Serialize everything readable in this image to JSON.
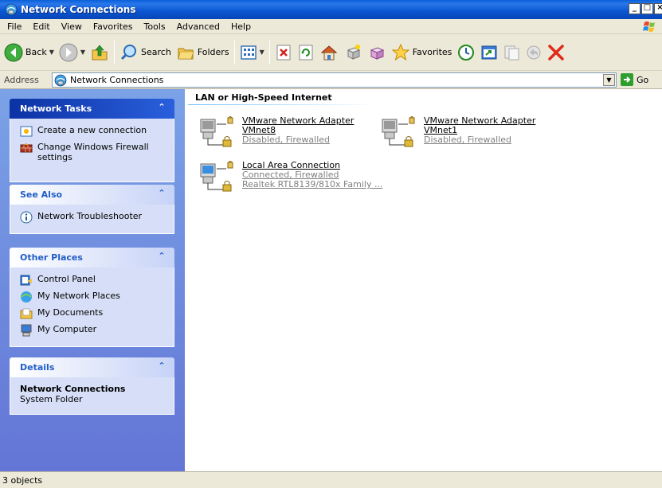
{
  "window": {
    "title": "Network Connections"
  },
  "menu": [
    "File",
    "Edit",
    "View",
    "Favorites",
    "Tools",
    "Advanced",
    "Help"
  ],
  "toolbar": {
    "back_label": "Back",
    "search_label": "Search",
    "folders_label": "Folders",
    "favorites_label": "Favorites"
  },
  "address": {
    "label": "Address",
    "value": "Network Connections",
    "go_label": "Go"
  },
  "taskpane": {
    "network_tasks": {
      "title": "Network Tasks",
      "items": [
        "Create a new connection",
        "Change Windows Firewall settings"
      ]
    },
    "see_also": {
      "title": "See Also",
      "items": [
        "Network Troubleshooter"
      ]
    },
    "other_places": {
      "title": "Other Places",
      "items": [
        "Control Panel",
        "My Network Places",
        "My Documents",
        "My Computer"
      ]
    },
    "details": {
      "title": "Details",
      "name": "Network Connections",
      "type": "System Folder"
    }
  },
  "content": {
    "group_title": "LAN or High-Speed Internet",
    "connections": [
      {
        "name1": "VMware Network Adapter",
        "name2": "VMnet8",
        "status": "Disabled, Firewalled"
      },
      {
        "name1": "VMware Network Adapter",
        "name2": "VMnet1",
        "status": "Disabled, Firewalled"
      },
      {
        "name1": "Local Area Connection",
        "status": "Connected, Firewalled",
        "device": "Realtek RTL8139/810x Family ..."
      }
    ]
  },
  "statusbar": {
    "text": "3 objects"
  }
}
